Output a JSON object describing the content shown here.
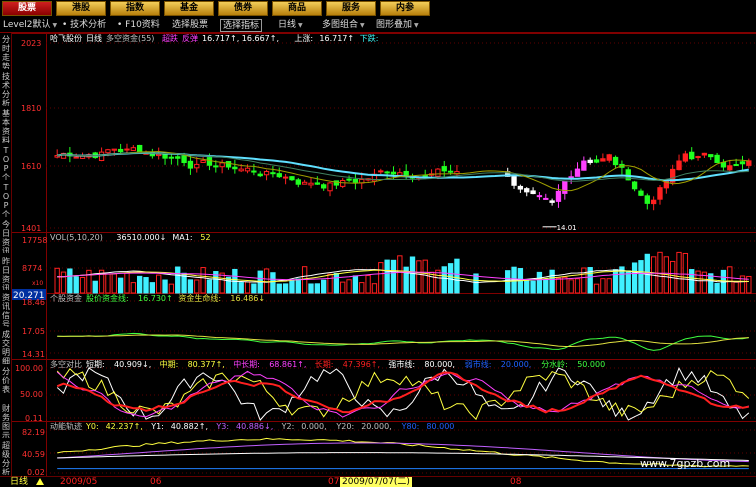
{
  "top_tabs": [
    {
      "label": "股票",
      "active": true
    },
    {
      "label": "港股",
      "active": false
    },
    {
      "label": "指数",
      "active": false
    },
    {
      "label": "基金",
      "active": false
    },
    {
      "label": "债券",
      "active": false
    },
    {
      "label": "商品",
      "active": false
    },
    {
      "label": "服务",
      "active": false
    },
    {
      "label": "内参",
      "active": false
    }
  ],
  "toolbar": {
    "level2": "Level2默认",
    "tech": "技术分析",
    "f10": "F10资料",
    "select_stock": "选择股票",
    "select_indicator": "选择指标",
    "period": "日线",
    "multi": "多图组合",
    "overlay": "图形叠加"
  },
  "sidebar_tabs": [
    "分时走势",
    "技术分析",
    "基本资料",
    "TOP个股",
    "TOP个股",
    "今日资讯",
    "昨日资讯",
    "资讯信号",
    "成交明细",
    "分价表",
    "财务图示",
    "超级分析"
  ],
  "main_panel": {
    "header_name": "哈飞股份",
    "header_period": "日线",
    "header_indicator": "多空资金(55)",
    "header_status": "超跌",
    "header_rebound_label": "反弹",
    "header_rebound": "16.717↑, 16.667↑,",
    "header_up_label": "上涨:",
    "header_up": "16.717↑",
    "header_down_label": "下跌:",
    "y_labels": [
      "2023",
      "1810",
      "1610",
      "1401"
    ],
    "low_marker": "14.01"
  },
  "vol_panel": {
    "header": "VOL(5,10,20)",
    "value": "36510.000↓",
    "ma_label": "MA1:",
    "ma_value": "52",
    "y_labels": [
      "17758",
      "8774"
    ],
    "unit": "x10",
    "current": "20.271"
  },
  "fund_panel": {
    "header": "个股资金",
    "line1_label": "股价资金线:",
    "line1_value": "16.730↑",
    "line2_label": "资金生命线:",
    "line2_value": "16.486↓",
    "y_labels": [
      "18.46",
      "17.05",
      "14.31"
    ]
  },
  "ratio_panel": {
    "header": "多空对比",
    "short_label": "短期:",
    "short_value": "40.909↓,",
    "mid_label": "中期:",
    "mid_value": "80.377↑,",
    "midlong_label": "中长期:",
    "midlong_value": "68.861↑,",
    "long_label": "长期:",
    "long_value": "47.396↑,",
    "strong_label": "强市线:",
    "strong_value": "80.000,",
    "weak_label": "弱市线:",
    "weak_value": "20.000,",
    "split_label": "分水岭:",
    "split_value": "50.000",
    "y_labels": [
      "100.00",
      "50.00",
      "0.11"
    ]
  },
  "track_panel": {
    "header": "动能轨迹",
    "y0_label": "Y0:",
    "y0_value": "42.237↑,",
    "y1_label": "Y1:",
    "y1_value": "40.882↑,",
    "y3_label": "Y3:",
    "y3_value": "40.886↓,",
    "y2_label": "Y2:",
    "y2_value": "0.000,",
    "y20_label": "Y20:",
    "y20_value": "20.000,",
    "y80_label": "Y80:",
    "y80_value": "80.000",
    "y_labels": [
      "82.19",
      "40.59",
      "0.02"
    ]
  },
  "bottom_bar": {
    "period": "日线",
    "date1": "2009/05",
    "month2": "06",
    "month3": "07",
    "cursor_date": "2009/07/07(二)",
    "month4": "08"
  },
  "watermark": "www.7gpzb.com",
  "colors": {
    "up": "#ff2020",
    "down": "#20e0e0",
    "up_candle_green": "#20ff20",
    "bg": "#000000",
    "grid": "#800000",
    "axis_text": "#ff3030"
  }
}
